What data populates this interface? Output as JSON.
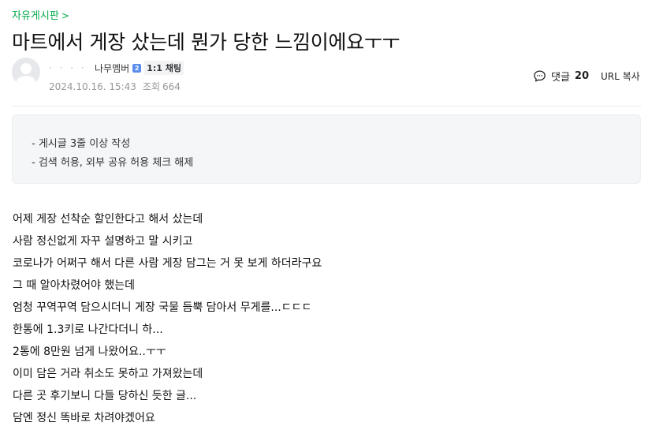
{
  "board": {
    "name": "자유게시판",
    "chevron": ">"
  },
  "post": {
    "title": "마트에서 게장 샀는데 뭔가 당한 느낌이에요ㅜㅜ",
    "author": {
      "nickname": "· · · ·",
      "grade": "나무멤버",
      "level_badge": "2",
      "chat_label": "1:1 채팅"
    },
    "date": "2024.10.16. 15:43",
    "views_label": "조회",
    "views": "664",
    "comments_label": "댓글",
    "comments_count": "20",
    "url_copy_label": "URL 복사"
  },
  "notice": {
    "lines": [
      "- 게시글 3줄 이상 작성",
      "- 검색 허용, 외부 공유 허용 체크 해제"
    ]
  },
  "content": {
    "lines": [
      "어제 게장 선착순 할인한다고 해서 샀는데",
      "사람 정신없게 자꾸 설명하고 말 시키고",
      "코로나가 어쩌구 해서 다른 사람 게장 담그는 거 못 보게 하더라구요",
      "그 때 알아차렸어야 했는데",
      "엄청 꾸역꾸역 담으시더니 게장 국물 듬뿍 담아서 무게를...ㄷㄷㄷ",
      "한통에 1.3키로 나간다더니 하...",
      "2통에 8만원 넘게 나왔어요..ㅜㅜ",
      "이미 담은 거라 취소도 못하고 가져왔는데",
      "다른 곳 후기보니 다들 당하신 듯한 글...",
      "담엔 정신 똑바로 차려야겠어요"
    ]
  },
  "colors": {
    "accent": "#03a94b",
    "meta": "#979797",
    "notice_bg": "#f5f6f8"
  },
  "icons": {
    "comment": "speech-bubble-icon",
    "level": "level-badge-icon",
    "avatar": "default-profile-icon"
  }
}
